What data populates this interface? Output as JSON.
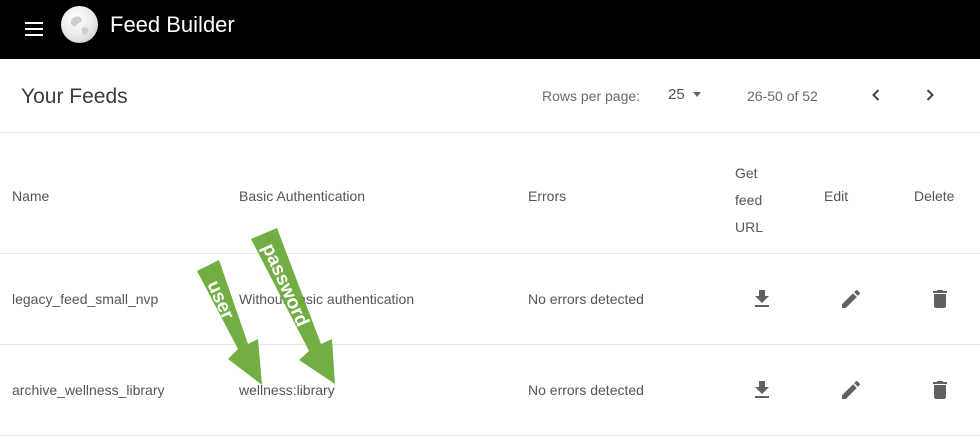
{
  "appbar": {
    "title": "Feed Builder",
    "menu_icon": "menu-icon",
    "logo_icon": "globe-logo-icon",
    "bg_color": "#000000"
  },
  "toolbar": {
    "title": "Your Feeds",
    "rows_per_page_label": "Rows per page:",
    "rows_per_page_value": "25",
    "range_text": "26-50 of 52",
    "prev_icon": "chevron-left-icon",
    "next_icon": "chevron-right-icon"
  },
  "table": {
    "headers": {
      "name": "Name",
      "basic_auth": "Basic Authentication",
      "errors": "Errors",
      "feed_url_line1": "Get",
      "feed_url_line2": "feed",
      "feed_url_line3": "URL",
      "edit": "Edit",
      "delete": "Delete"
    },
    "rows": [
      {
        "name": "legacy_feed_small_nvp",
        "basic_auth": "Without basic authentication",
        "errors": "No errors detected"
      },
      {
        "name": "archive_wellness_library",
        "basic_auth": "wellness:library",
        "errors": "No errors detected"
      }
    ],
    "row_icons": {
      "get_url": "download-icon",
      "edit": "pencil-icon",
      "delete": "trash-icon"
    }
  },
  "annotations": {
    "user_label": "user",
    "password_label": "password",
    "arrow_color": "#6aaa3a"
  }
}
